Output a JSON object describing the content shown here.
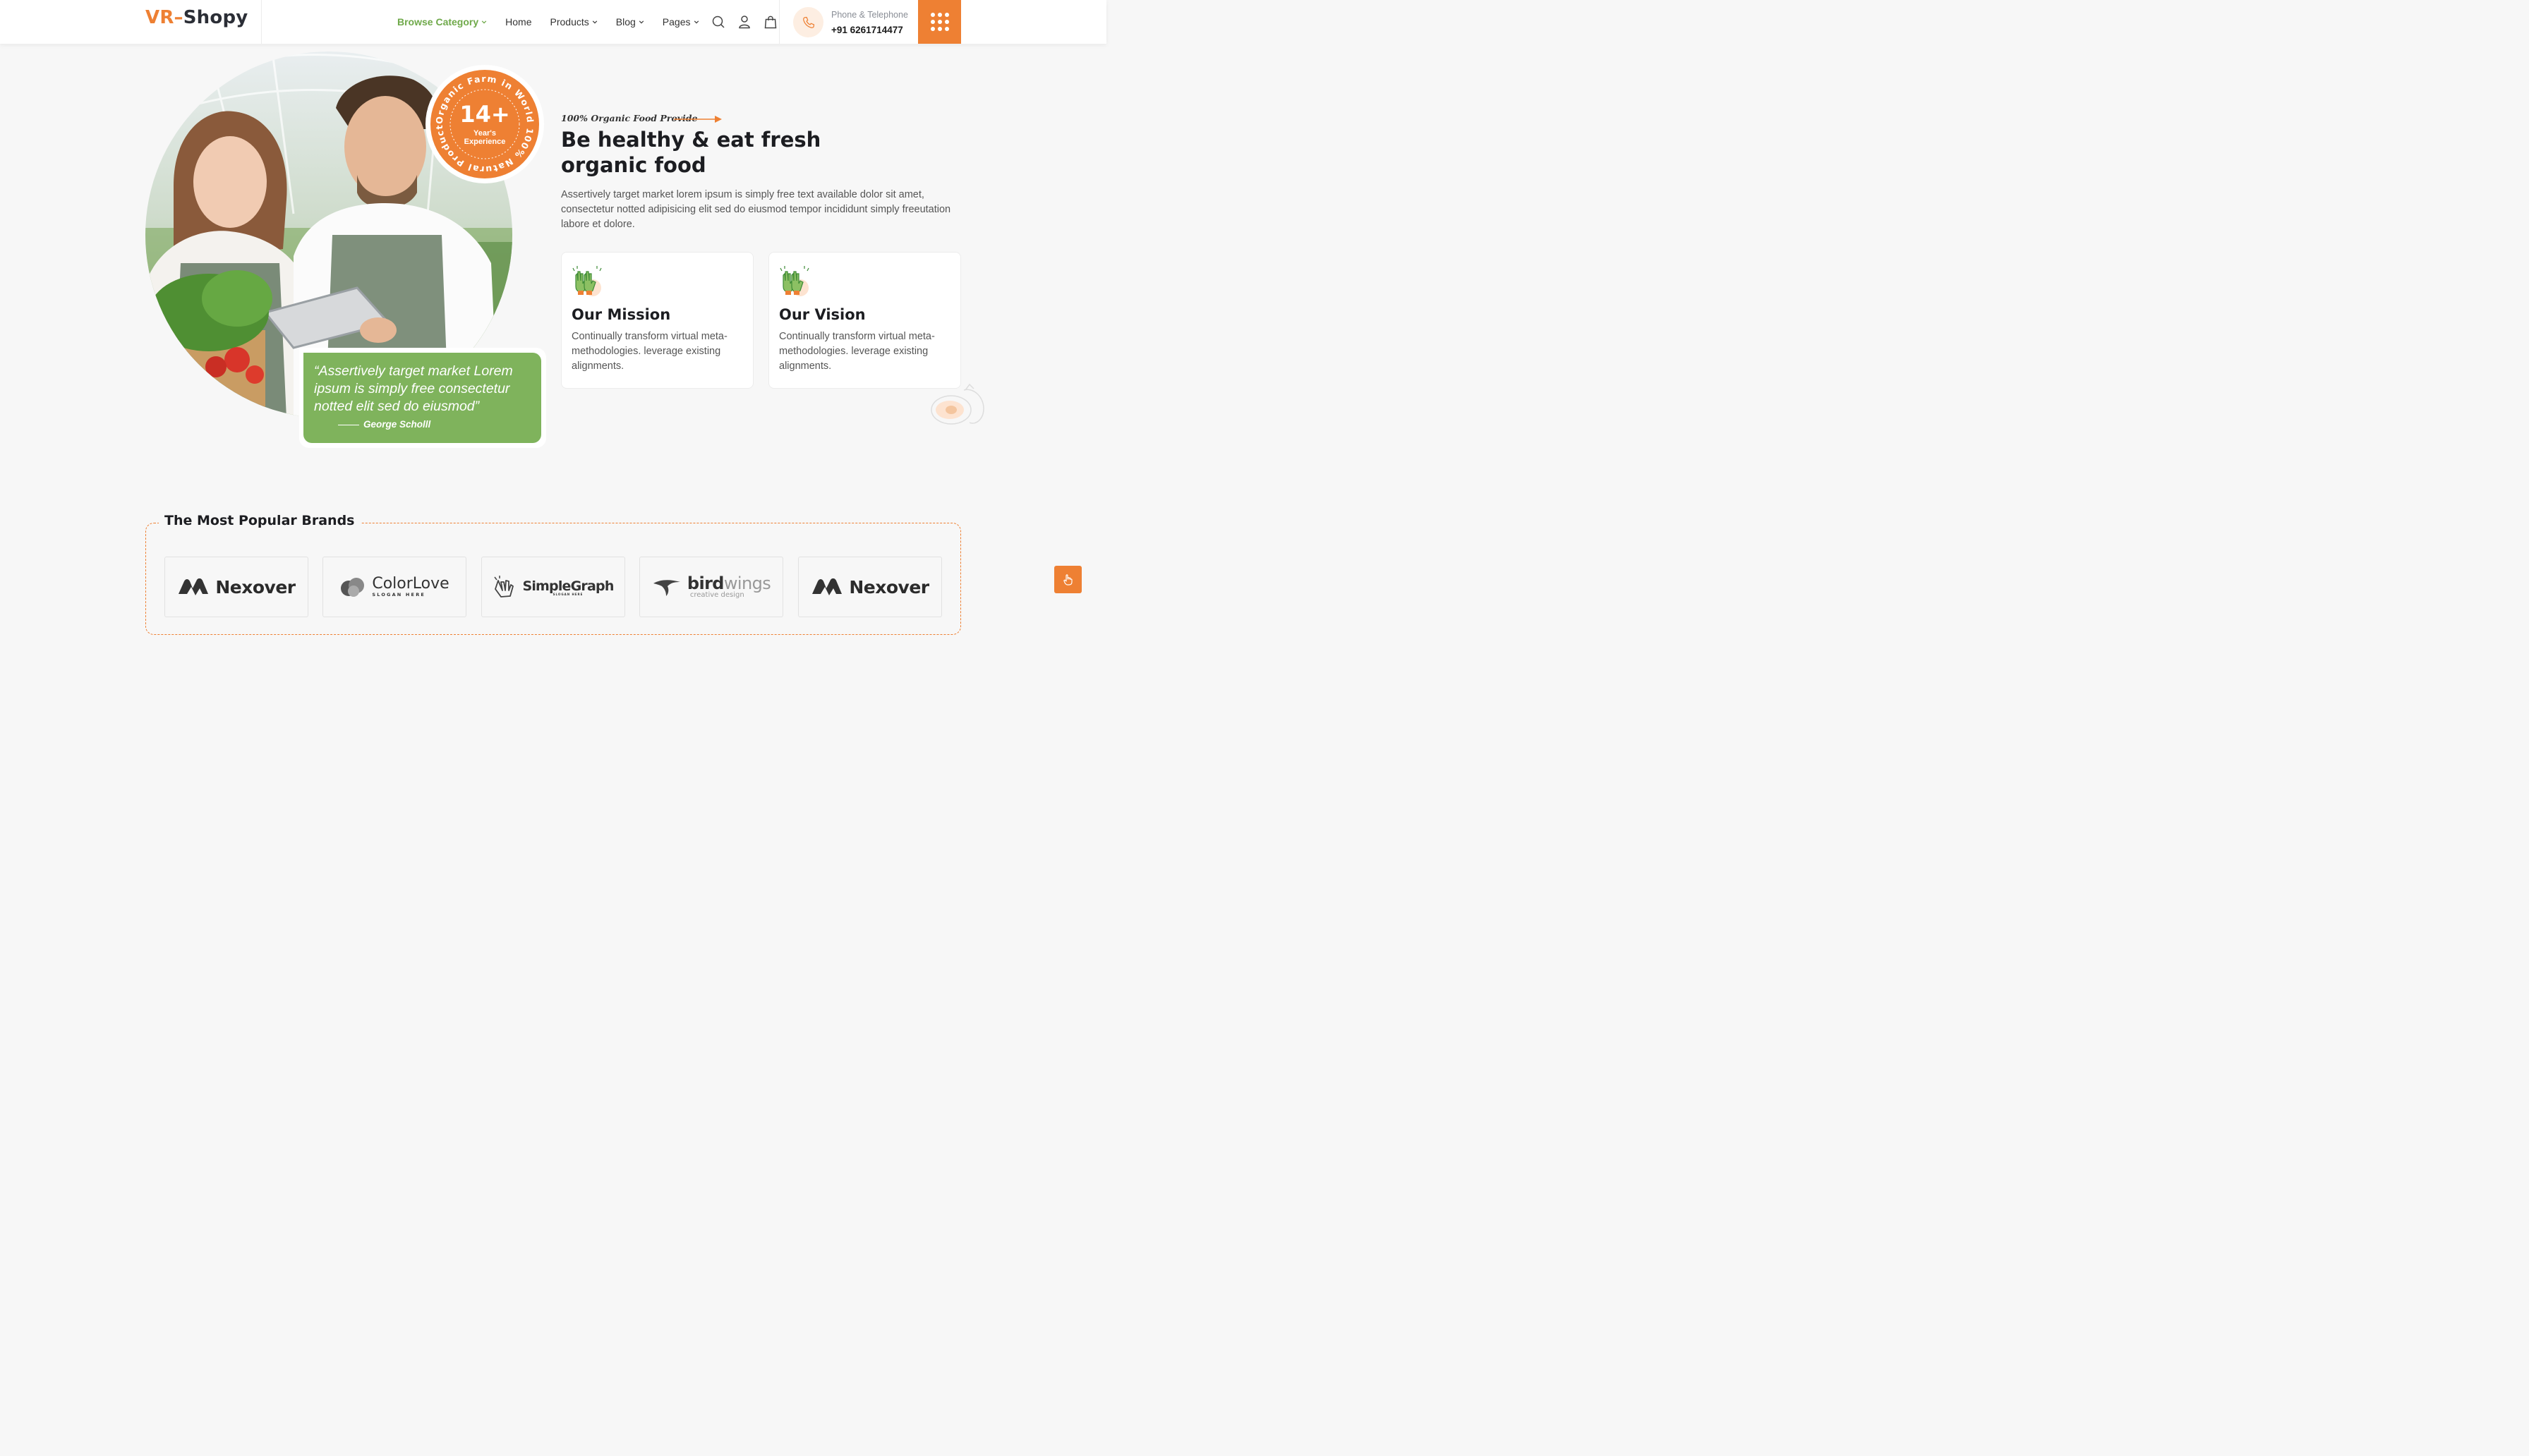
{
  "header": {
    "logo_part1": "VR",
    "logo_dash": "–",
    "logo_part2": "Shopy",
    "nav": [
      {
        "label": "Browse Category",
        "has_dropdown": true,
        "active": true
      },
      {
        "label": "Home",
        "has_dropdown": false
      },
      {
        "label": "Products",
        "has_dropdown": true
      },
      {
        "label": "Blog",
        "has_dropdown": true
      },
      {
        "label": "Pages",
        "has_dropdown": true
      }
    ],
    "icons": [
      "search-icon",
      "user-icon",
      "shopping-bag-icon"
    ],
    "phone_label": "Phone & Telephone",
    "phone_number": "+91 6261714477",
    "menu_icon": "grid-dots-icon"
  },
  "hero": {
    "badge_number": "14+",
    "badge_line1": "Year's",
    "badge_line2": "Experience",
    "badge_ring_text": "Organic Farm in World 100% Natural Products Best",
    "quote": "“Assertively target market Lorem ipsum is simply free consectetur notted elit sed do eiusmod”",
    "quote_author": "George Scholll",
    "eyebrow": "100% Organic Food Provide",
    "title_line1": "Be healthy & eat fresh",
    "title_line2": "organic food",
    "description": "Assertively target market lorem ipsum is simply free text available dolor sit amet, consectetur notted adipisicing elit sed do eiusmod tempor incididunt simply freeutation labore et dolore.",
    "cards": [
      {
        "title": "Our Mission",
        "text": "Continually transform virtual meta-methodologies. leverage existing alignments.",
        "icon": "gloves-icon"
      },
      {
        "title": "Our Vision",
        "text": "Continually transform virtual meta-methodologies. leverage existing alignments.",
        "icon": "gloves-icon"
      }
    ]
  },
  "brands": {
    "title": "The Most Popular Brands",
    "items": [
      {
        "name": "Nexover"
      },
      {
        "name": "ColorLove",
        "sub": "SLOGAN HERE"
      },
      {
        "name": "SimpleGraph",
        "sub": "SLOGAN HERE"
      },
      {
        "name1": "bird",
        "name2": "wings",
        "sub": "creative design"
      },
      {
        "name": "Nexover"
      }
    ]
  },
  "colors": {
    "accent": "#ee8033",
    "green": "#7fb35c",
    "nav_active": "#6fa94a",
    "heading": "#1c1d21"
  }
}
